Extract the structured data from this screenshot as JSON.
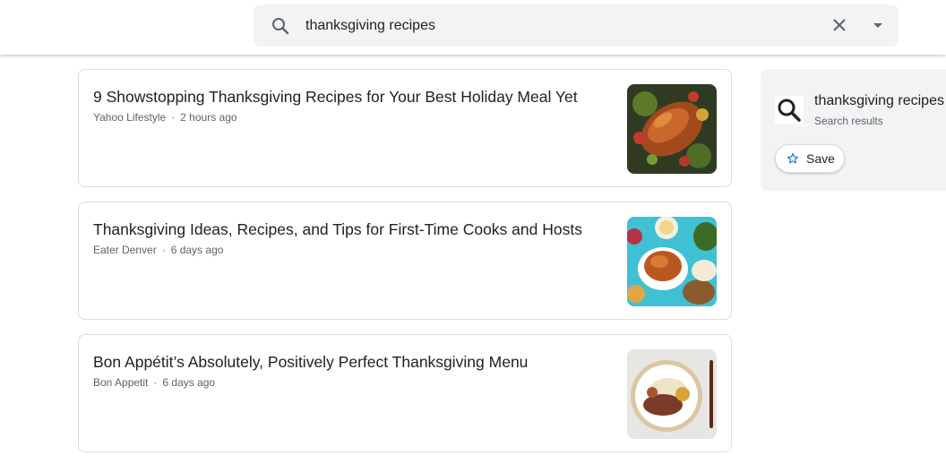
{
  "search": {
    "query": "thanksgiving recipes"
  },
  "icons": {
    "search": "search-icon",
    "clear": "close-icon",
    "dropdown": "caret-down-icon",
    "save": "star-outline-icon"
  },
  "articles": [
    {
      "title": "9 Showstopping Thanksgiving Recipes for Your Best Holiday Meal Yet",
      "source": "Yahoo Lifestyle",
      "separator": "·",
      "time": "2 hours ago"
    },
    {
      "title": "Thanksgiving Ideas, Recipes, and Tips for First-Time Cooks and Hosts",
      "source": "Eater Denver",
      "separator": "·",
      "time": "6 days ago"
    },
    {
      "title": "Bon Appétit’s Absolutely, Positively Perfect Thanksgiving Menu",
      "source": "Bon Appetit",
      "separator": "·",
      "time": "6 days ago"
    }
  ],
  "side_panel": {
    "title": "thanksgiving recipes",
    "subtitle": "Search results",
    "save_label": "Save"
  },
  "colors": {
    "accent": "#1a73e8",
    "search_bg": "#f1f3f4",
    "border": "#dadce0"
  }
}
